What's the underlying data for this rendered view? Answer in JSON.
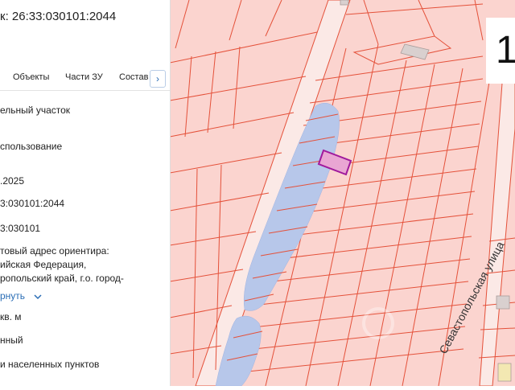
{
  "panel": {
    "title": "к: 26:33:030101:2044",
    "tabs": [
      "Объекты",
      "Части ЗУ",
      "Состав"
    ],
    "tab_arrow": "›",
    "fields": [
      {
        "text": "ельный участок"
      },
      {
        "text": "спользование"
      },
      {
        "text": ".2025"
      },
      {
        "text": "3:030101:2044"
      },
      {
        "text": "3:030101"
      },
      {
        "lines": [
          "товый адрес ориентира:",
          "ийская Федерация,",
          "ропольский край, г.о. город-"
        ]
      },
      {
        "link": "рнуть"
      },
      {
        "text": "кв. м"
      },
      {
        "text": "нный"
      },
      {
        "text": "и населенных пунктов"
      }
    ]
  },
  "map": {
    "badge": "1",
    "street_label": "Севастопольская улица",
    "colors": {
      "background": "#fbd4cf",
      "parcel_line": "#e4513a",
      "water": "#b7c7ea",
      "road": "#fbe9e6",
      "building": "#d9d0cf",
      "selected_parcel": "#e9a6d3",
      "selected_outline": "#a0199c"
    }
  }
}
